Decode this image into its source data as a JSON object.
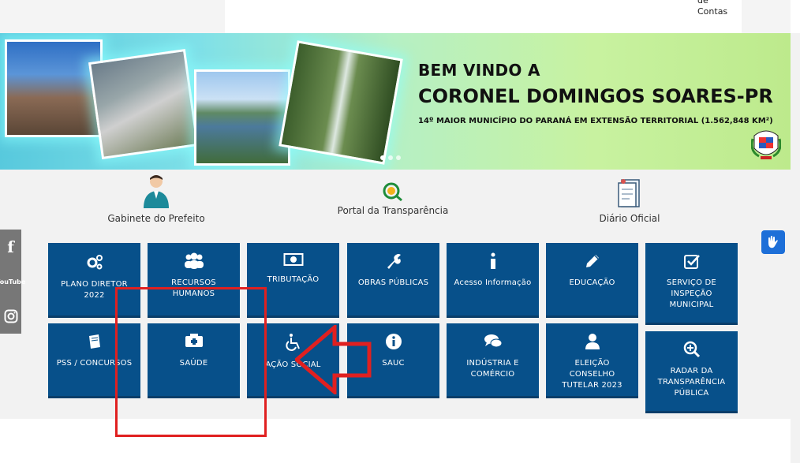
{
  "header": {
    "account_text_line1": "de",
    "account_text_line2": "Contas"
  },
  "banner": {
    "welcome_line1": "BEM VINDO A",
    "welcome_line2": "CORONEL DOMINGOS SOARES-PR",
    "welcome_line3": "14º MAIOR MUNICÍPIO DO PARANÁ EM EXTENSÃO TERRITORIAL (1.562,848 KM²)",
    "slide_count": 3,
    "active_slide": 1
  },
  "quick_links": [
    {
      "label": "Gabinete do Prefeito",
      "icon": "person-suit-icon"
    },
    {
      "label": "Portal da Transparência",
      "icon": "magnifier-coin-icon"
    },
    {
      "label": "Diário Oficial",
      "icon": "document-icon"
    }
  ],
  "social": {
    "facebook": "f",
    "youtube": "YouTube",
    "instagram": "instagram-icon"
  },
  "tiles": [
    {
      "label": "PLANO DIRETOR 2022",
      "icon": "gears-icon"
    },
    {
      "label": "RECURSOS HUMANOS",
      "icon": "users-icon"
    },
    {
      "label": "TRIBUTAÇÃO",
      "icon": "money-icon"
    },
    {
      "label": "OBRAS PÚBLICAS",
      "icon": "wrench-icon"
    },
    {
      "label": "Acesso Informação",
      "icon": "info-icon"
    },
    {
      "label": "EDUCAÇÃO",
      "icon": "pencil-icon"
    },
    {
      "label": "SERVIÇO DE INSPEÇÃO MUNICIPAL",
      "icon": "checkbox-icon"
    },
    {
      "label": "PSS / CONCURSOS",
      "icon": "book-icon"
    },
    {
      "label": "SAÚDE",
      "icon": "ambulance-icon"
    },
    {
      "label": "AÇÃO SOCIAL",
      "icon": "wheelchair-icon"
    },
    {
      "label": "SAUC",
      "icon": "info-circle-icon"
    },
    {
      "label": "INDÚSTRIA E COMÉRCIO",
      "icon": "chat-icon"
    },
    {
      "label": "ELEIÇÃO CONSELHO TUTELAR 2023",
      "icon": "user-icon"
    },
    {
      "label": "RADAR DA TRANSPARÊNCIA PÚBLICA",
      "icon": "zoom-in-icon"
    }
  ],
  "colors": {
    "tile_bg": "#07508a",
    "highlight": "#e02020",
    "accessibility": "#1d6fd8"
  }
}
